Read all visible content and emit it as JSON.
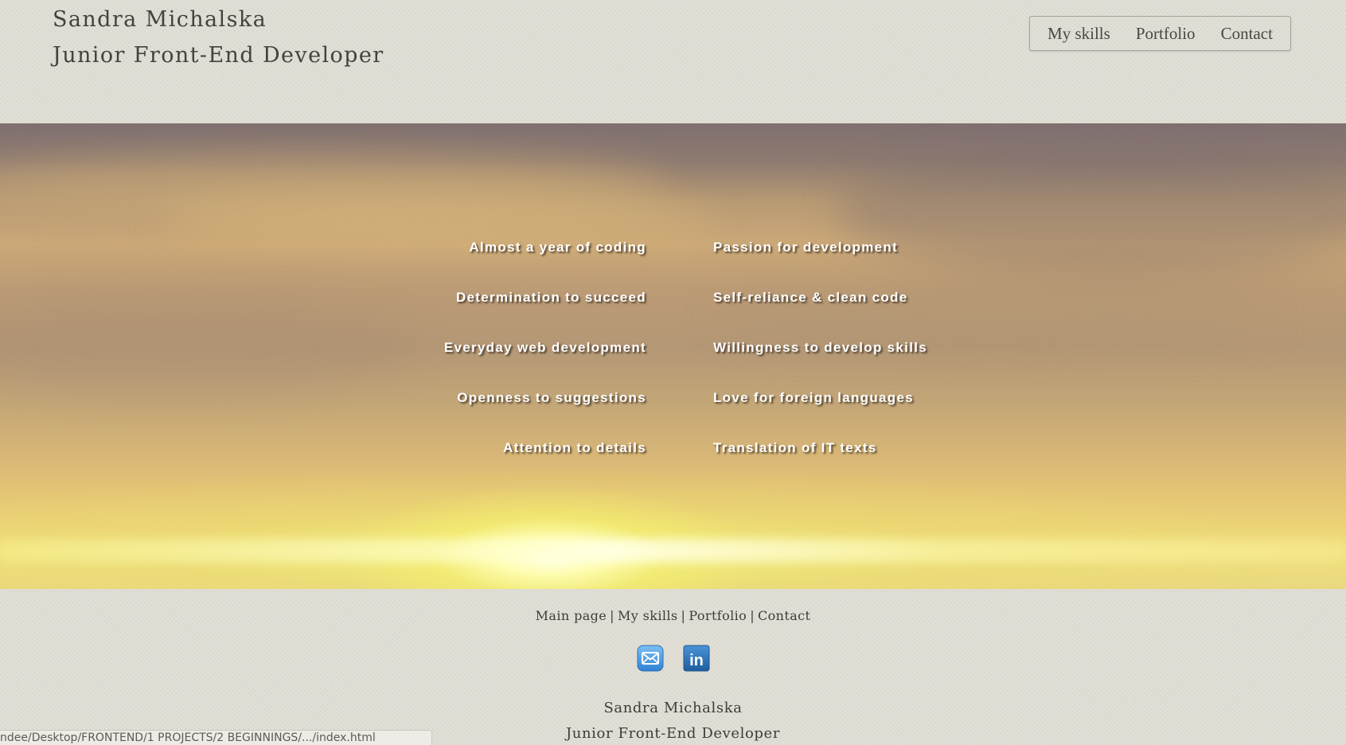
{
  "header": {
    "name": "Sandra Michalska",
    "title": "Junior Front-End Developer"
  },
  "top_nav": {
    "items": [
      {
        "label": "My skills"
      },
      {
        "label": "Portfolio"
      },
      {
        "label": "Contact"
      }
    ]
  },
  "skills": {
    "left": [
      "Almost a year of coding",
      "Determination to succeed",
      "Everyday web development",
      "Openness to suggestions",
      "Attention to details"
    ],
    "right": [
      "Passion for development",
      "Self-reliance & clean code",
      "Willingness to develop skills",
      "Love for foreign languages",
      "Translation of IT texts"
    ]
  },
  "footer": {
    "nav": [
      {
        "label": "Main page"
      },
      {
        "label": "My skills"
      },
      {
        "label": "Portfolio"
      },
      {
        "label": "Contact"
      }
    ],
    "separator": "|",
    "social": [
      {
        "icon": "email-icon"
      },
      {
        "icon": "linkedin-icon",
        "text": "in"
      }
    ],
    "name": "Sandra Michalska",
    "title": "Junior Front-End Developer"
  },
  "status_bar": {
    "url": "ndee/Desktop/FRONTEND/1 PROJECTS/2 BEGINNINGS/.../index.html"
  },
  "colors": {
    "background": "#e1dfd6",
    "text": "#3c3a36",
    "skill_text": "#ffffff",
    "linkedin": "#2f73b6",
    "mail": "#4a9be0"
  }
}
